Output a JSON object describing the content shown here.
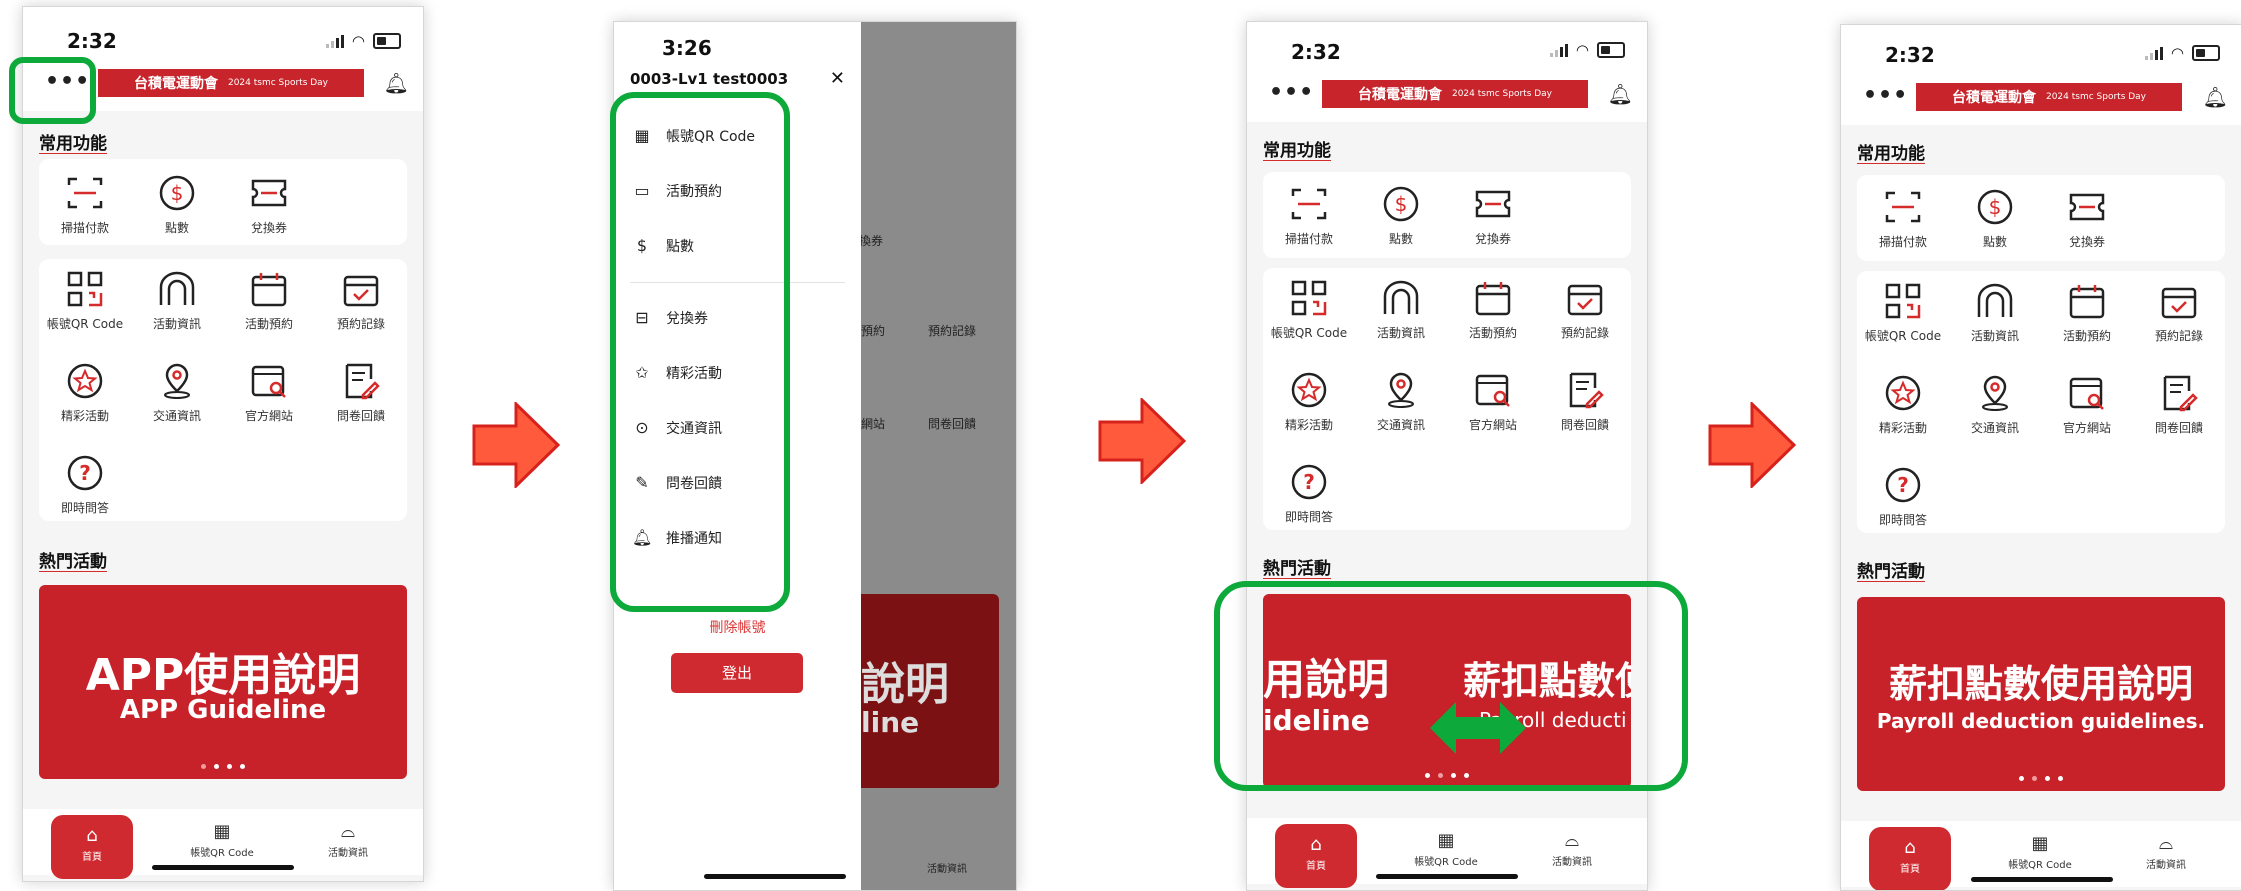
{
  "status": {
    "time_1": "2:32",
    "time_2": "3:26",
    "time_3": "2:32",
    "time_4": "2:32"
  },
  "header": {
    "banner_title": "台積電運動會",
    "banner_sub": "2024 tsmc Sports Day"
  },
  "sections": {
    "common": "常用功能",
    "hot": "熱門活動"
  },
  "quick": [
    {
      "label": "掃描付款",
      "icon": "scan-icon"
    },
    {
      "label": "點數",
      "icon": "points-icon"
    },
    {
      "label": "兌換券",
      "icon": "voucher-icon"
    }
  ],
  "features": [
    {
      "label": "帳號QR Code",
      "icon": "qr-code-icon"
    },
    {
      "label": "活動資訊",
      "icon": "activity-info-icon"
    },
    {
      "label": "活動預約",
      "icon": "calendar-icon"
    },
    {
      "label": "預約記錄",
      "icon": "calendar-check-icon"
    },
    {
      "label": "精彩活動",
      "icon": "star-icon"
    },
    {
      "label": "交通資訊",
      "icon": "location-icon"
    },
    {
      "label": "官方網站",
      "icon": "website-icon"
    },
    {
      "label": "問卷回饋",
      "icon": "survey-icon"
    },
    {
      "label": "即時問答",
      "icon": "question-icon"
    }
  ],
  "promos": {
    "app_title": "APP使用說明",
    "app_sub": "APP Guideline",
    "payroll_title": "薪扣點數使用說明",
    "payroll_sub": "Payroll deduction guidelines.",
    "swipe_left_title": "用說明",
    "swipe_left_sub": "ideline",
    "swipe_right_title": "薪扣點數使",
    "swipe_right_sub": "Payroll deducti"
  },
  "bottom_nav": {
    "home": "首頁",
    "qr": "帳號QR Code",
    "activity": "活動資訊"
  },
  "drawer": {
    "account": "0003-Lv1 test0003",
    "items": [
      "帳號QR Code",
      "活動預約",
      "點數",
      "兌換券",
      "精彩活動",
      "交通資訊",
      "問卷回饋",
      "推播通知"
    ],
    "delete_account": "刪除帳號",
    "logout": "登出"
  },
  "behind_drawer": {
    "voucher": "換券",
    "reserve": "預約",
    "record": "預約記錄",
    "site": "網站",
    "survey": "問卷回饋",
    "promo_title": "說明",
    "promo_sub": "line",
    "nav_activity": "活動資訊"
  },
  "colors": {
    "brand_red": "#cf2a2f",
    "highlight_green": "#0daa3b",
    "arrow": "#ff5a3c"
  }
}
